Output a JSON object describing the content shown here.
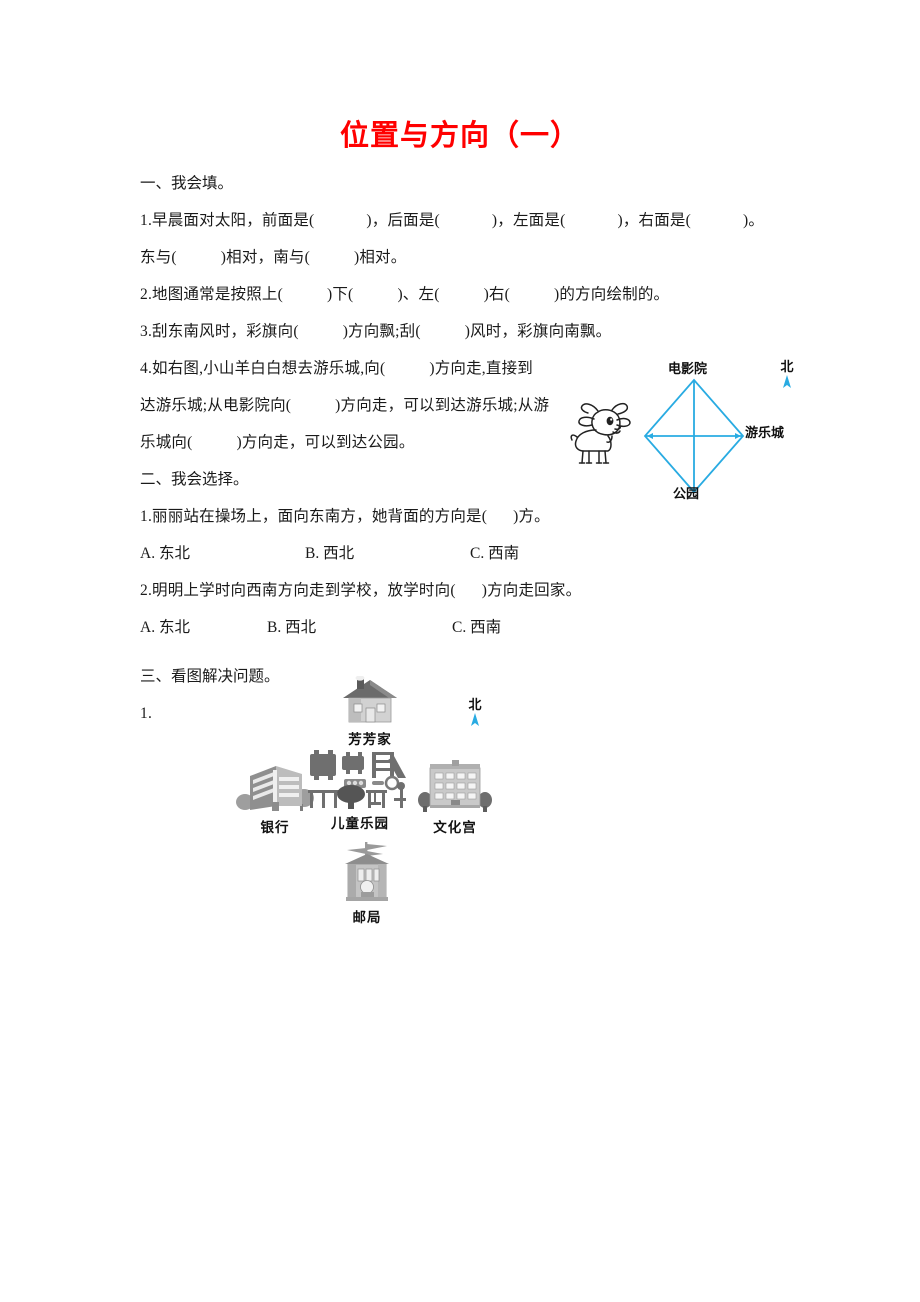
{
  "title": "位置与方向（一）",
  "title_color": "#ff0000",
  "accent_color": "#29abe2",
  "section1": {
    "heading": "一、我会填。",
    "q1_a": "1.早晨面对太阳，前面是(",
    "q1_b": ")，后面是(",
    "q1_c": ")，左面是(",
    "q1_d": ")，右面是(",
    "q1_e": ")。",
    "q1_line2_a": "东与(",
    "q1_line2_b": ")相对，南与(",
    "q1_line2_c": ")相对。",
    "q2_a": "2.地图通常是按照上(",
    "q2_b": ")下(",
    "q2_c": ")、左(",
    "q2_d": ")右(",
    "q2_e": ")的方向绘制的。",
    "q3_a": "3.刮东南风时，彩旗向(",
    "q3_b": ")方向飘;刮(",
    "q3_c": ")风时，彩旗向南飘。",
    "q4_a": "4.如右图,小山羊白白想去游乐城,向(",
    "q4_b": ")方向走,直接到",
    "q4_c": "达游乐城;从电影院向(",
    "q4_d": ")方向走，可以到达游乐城;从游",
    "q4_e": "乐城向(",
    "q4_f": ")方向走，可以到达公园。"
  },
  "section2": {
    "heading": "二、我会选择。",
    "q1_a": "1.丽丽站在操场上，面向东南方，她背面的方向是(",
    "q1_b": ")方。",
    "q1_options": [
      "A. 东北",
      "B. 西北",
      "C. 西南"
    ],
    "q2_a": "2.明明上学时向西南方向走到学校，放学时向(",
    "q2_b": ")方向走回家。",
    "q2_options": [
      "A. 东北",
      "B. 西北",
      "C. 西南"
    ]
  },
  "section3": {
    "heading": "三、看图解决问题。",
    "q1_number": "1."
  },
  "goat_figure": {
    "cinema": "电影院",
    "amusement": "游乐城",
    "park": "公园",
    "north": "北",
    "animal_icon": "goat-icon",
    "shape_icon": "diamond-compass-icon"
  },
  "map_figure": {
    "north": "北",
    "items": [
      {
        "label": "芳芳家",
        "icon": "house-icon"
      },
      {
        "label": "银行",
        "icon": "bank-building-icon"
      },
      {
        "label": "儿童乐园",
        "icon": "playground-icon"
      },
      {
        "label": "文化宫",
        "icon": "cultural-palace-icon"
      },
      {
        "label": "邮局",
        "icon": "post-office-icon"
      }
    ]
  }
}
